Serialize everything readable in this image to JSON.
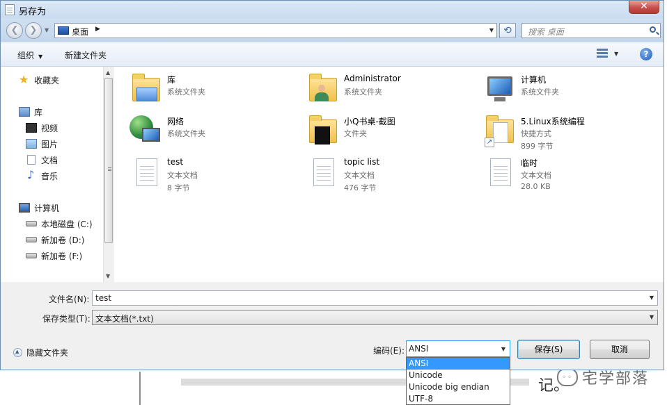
{
  "window": {
    "title": "另存为",
    "close_label": "✕"
  },
  "nav": {
    "back_label": "❮",
    "forward_label": "❯",
    "address": "桌面",
    "address_sep": "▶",
    "search_placeholder": "搜索 桌面"
  },
  "toolbar": {
    "organize": "组织",
    "new_folder": "新建文件夹",
    "help": "?"
  },
  "sidebar": {
    "favorites": "收藏夹",
    "libraries": "库",
    "lib_items": [
      "视频",
      "图片",
      "文档",
      "音乐"
    ],
    "computer": "计算机",
    "drives": [
      "本地磁盘 (C:)",
      "新加卷 (D:)",
      "新加卷 (F:)"
    ]
  },
  "files": [
    {
      "name": "库",
      "line1": "系统文件夹",
      "line2": "",
      "icon": "library-folder-icon"
    },
    {
      "name": "Administrator",
      "line1": "系统文件夹",
      "line2": "",
      "icon": "user-folder-icon"
    },
    {
      "name": "计算机",
      "line1": "系统文件夹",
      "line2": "",
      "icon": "computer-icon"
    },
    {
      "name": "网络",
      "line1": "系统文件夹",
      "line2": "",
      "icon": "network-icon"
    },
    {
      "name": "小Q书桌-截图",
      "line1": "文件夹",
      "line2": "",
      "icon": "folder-icon"
    },
    {
      "name": "5.Linux系统编程",
      "line1": "快捷方式",
      "line2": "899 字节",
      "icon": "shortcut-folder-icon"
    },
    {
      "name": "test",
      "line1": "文本文档",
      "line2": "8 字节",
      "icon": "text-file-icon"
    },
    {
      "name": "topic list",
      "line1": "文本文档",
      "line2": "476 字节",
      "icon": "text-file-icon"
    },
    {
      "name": "临时",
      "line1": "文本文档",
      "line2": "28.0 KB",
      "icon": "text-file-icon"
    }
  ],
  "form": {
    "filename_label": "文件名(N):",
    "filename_value": "test",
    "filetype_label": "保存类型(T):",
    "filetype_value": "文本文档(*.txt)",
    "hide_folders": "隐藏文件夹",
    "encoding_label": "编码(E):",
    "encoding_value": "ANSI",
    "encoding_options": [
      "ANSI",
      "Unicode",
      "Unicode big endian",
      "UTF-8"
    ],
    "save_button": "保存(S)",
    "cancel_button": "取消"
  },
  "watermark": {
    "text": "宅学部落"
  },
  "background": {
    "fragment": "记。"
  }
}
